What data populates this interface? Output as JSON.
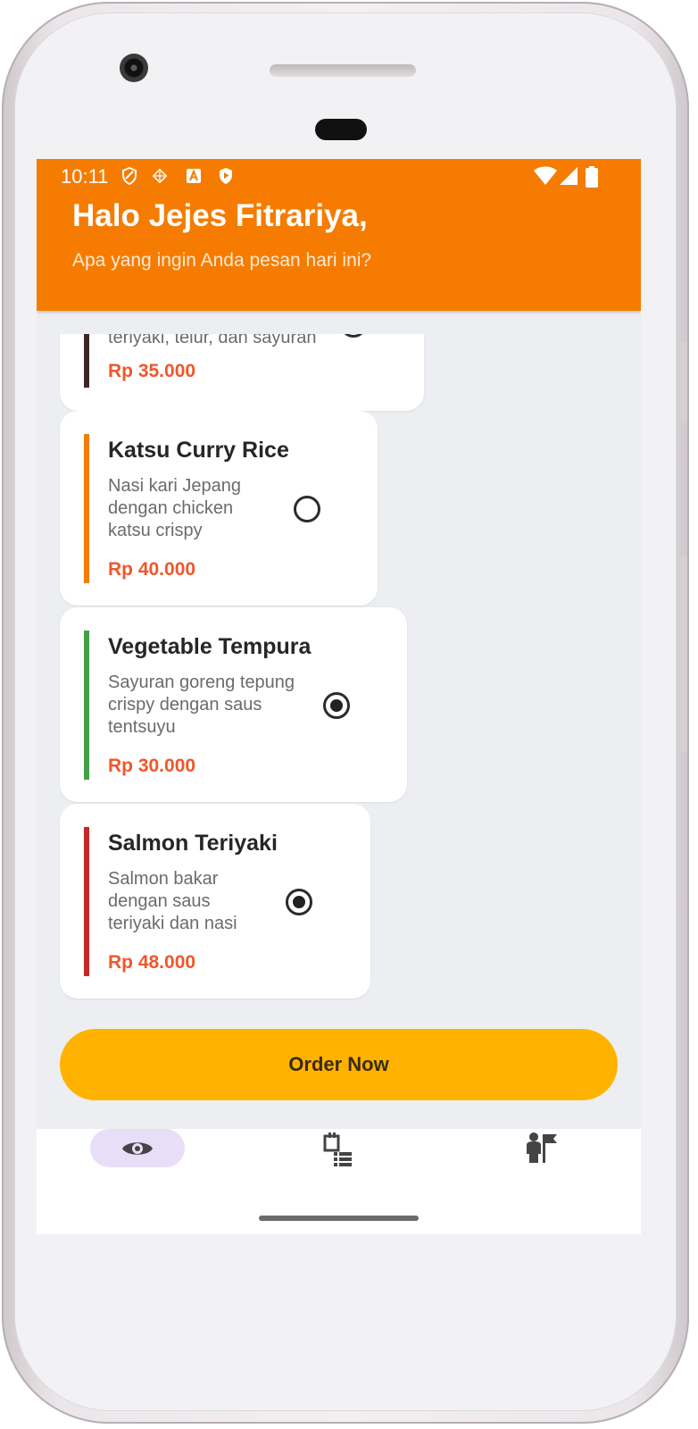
{
  "status_bar": {
    "time": "10:11",
    "left_icons": [
      "shield-outline-icon",
      "gesture-icon",
      "a-badge-icon",
      "shield-play-icon"
    ],
    "right_icons": [
      "wifi-icon",
      "signal-icon",
      "battery-icon"
    ]
  },
  "header": {
    "greeting": "Halo Jejes Fitrariya,",
    "subtitle": "Apa yang ingin Anda pesan hari ini?",
    "color": "#f57c00"
  },
  "menu_items": [
    {
      "name": "",
      "description": "teriyaki, telur, dan sayuran",
      "price": "Rp 35.000",
      "accent": "#3e2723",
      "selected": false
    },
    {
      "name": "Katsu Curry Rice",
      "description": "Nasi kari Jepang dengan chicken katsu crispy",
      "price": "Rp 40.000",
      "accent": "#f57c00",
      "selected": false
    },
    {
      "name": "Vegetable Tempura",
      "description": "Sayuran goreng tepung crispy dengan saus tentsuyu",
      "price": "Rp 30.000",
      "accent": "#43a047",
      "selected": true
    },
    {
      "name": "Salmon Teriyaki",
      "description": "Salmon bakar dengan saus teriyaki dan nasi",
      "price": "Rp 48.000",
      "accent": "#c62828",
      "selected": true
    }
  ],
  "order_button": {
    "label": "Order Now",
    "color": "#ffb300"
  },
  "bottom_nav": {
    "items": [
      {
        "icon": "eye-icon",
        "active": true
      },
      {
        "icon": "order-list-icon",
        "active": false
      },
      {
        "icon": "person-flag-icon",
        "active": false
      }
    ]
  }
}
